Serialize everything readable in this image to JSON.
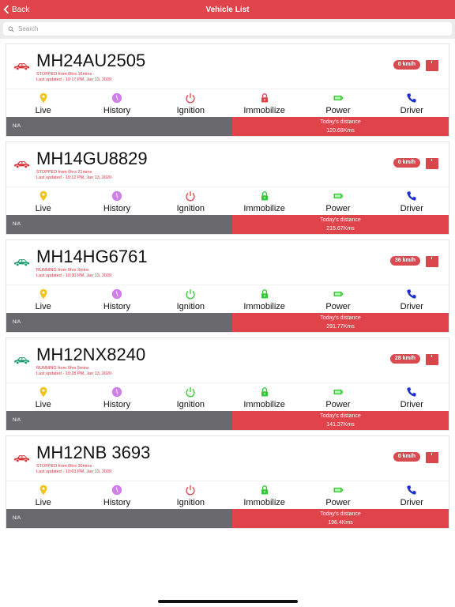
{
  "nav": {
    "back_label": "Back",
    "title": "Vehicle List"
  },
  "search": {
    "placeholder": "Search",
    "value": ""
  },
  "colors": {
    "accent": "#e0434a",
    "stopped_car": "#d8313a",
    "running_car": "#1f9a6e",
    "gray_bar": "#6a6a6e"
  },
  "action_labels": {
    "live": "Live",
    "history": "History",
    "ignition": "Ignition",
    "immobilize": "Immobilize",
    "power": "Power",
    "driver": "Driver"
  },
  "vehicles": [
    {
      "plate": "MH24AU2505",
      "status": "STOPPED from 0hrs 16mins",
      "updated": "Last updated - 10:17 PM, Jan 13, 2020",
      "speed": "0 km/h",
      "car_state": "stopped",
      "ignition_on": false,
      "immobilized": true,
      "left_text": "N/A",
      "distance_label": "Today's distance",
      "distance": "120.68Kms"
    },
    {
      "plate": "MH14GU8829",
      "status": "STOPPED from 0hrs 21mins",
      "updated": "Last updated - 10:12 PM, Jan 13, 2020",
      "speed": "0 km/h",
      "car_state": "stopped",
      "ignition_on": false,
      "immobilized": false,
      "left_text": "N/A",
      "distance_label": "Today's distance",
      "distance": "215.67Kms"
    },
    {
      "plate": "MH14HG6761",
      "status": "RUNNING from 0hrs 3mins",
      "updated": "Last updated - 10:30 PM, Jan 13, 2020",
      "speed": "36 km/h",
      "car_state": "running",
      "ignition_on": true,
      "immobilized": false,
      "left_text": "N/A",
      "distance_label": "Today's distance",
      "distance": "291.77Kms"
    },
    {
      "plate": "MH12NX8240",
      "status": "RUNNING from 0hrs 5mins",
      "updated": "Last updated - 10:28 PM, Jan 13, 2020",
      "speed": "28 km/h",
      "car_state": "running",
      "ignition_on": true,
      "immobilized": false,
      "left_text": "N/A",
      "distance_label": "Today's distance",
      "distance": "141.37Kms"
    },
    {
      "plate": "MH12NB 3693",
      "status": "STOPPED from 0hrs 30mins",
      "updated": "Last updated - 10:03 PM, Jan 13, 2020",
      "speed": "0 km/h",
      "car_state": "stopped",
      "ignition_on": false,
      "immobilized": false,
      "left_text": "N/A",
      "distance_label": "Today's distance",
      "distance": "196.4Kms"
    }
  ]
}
